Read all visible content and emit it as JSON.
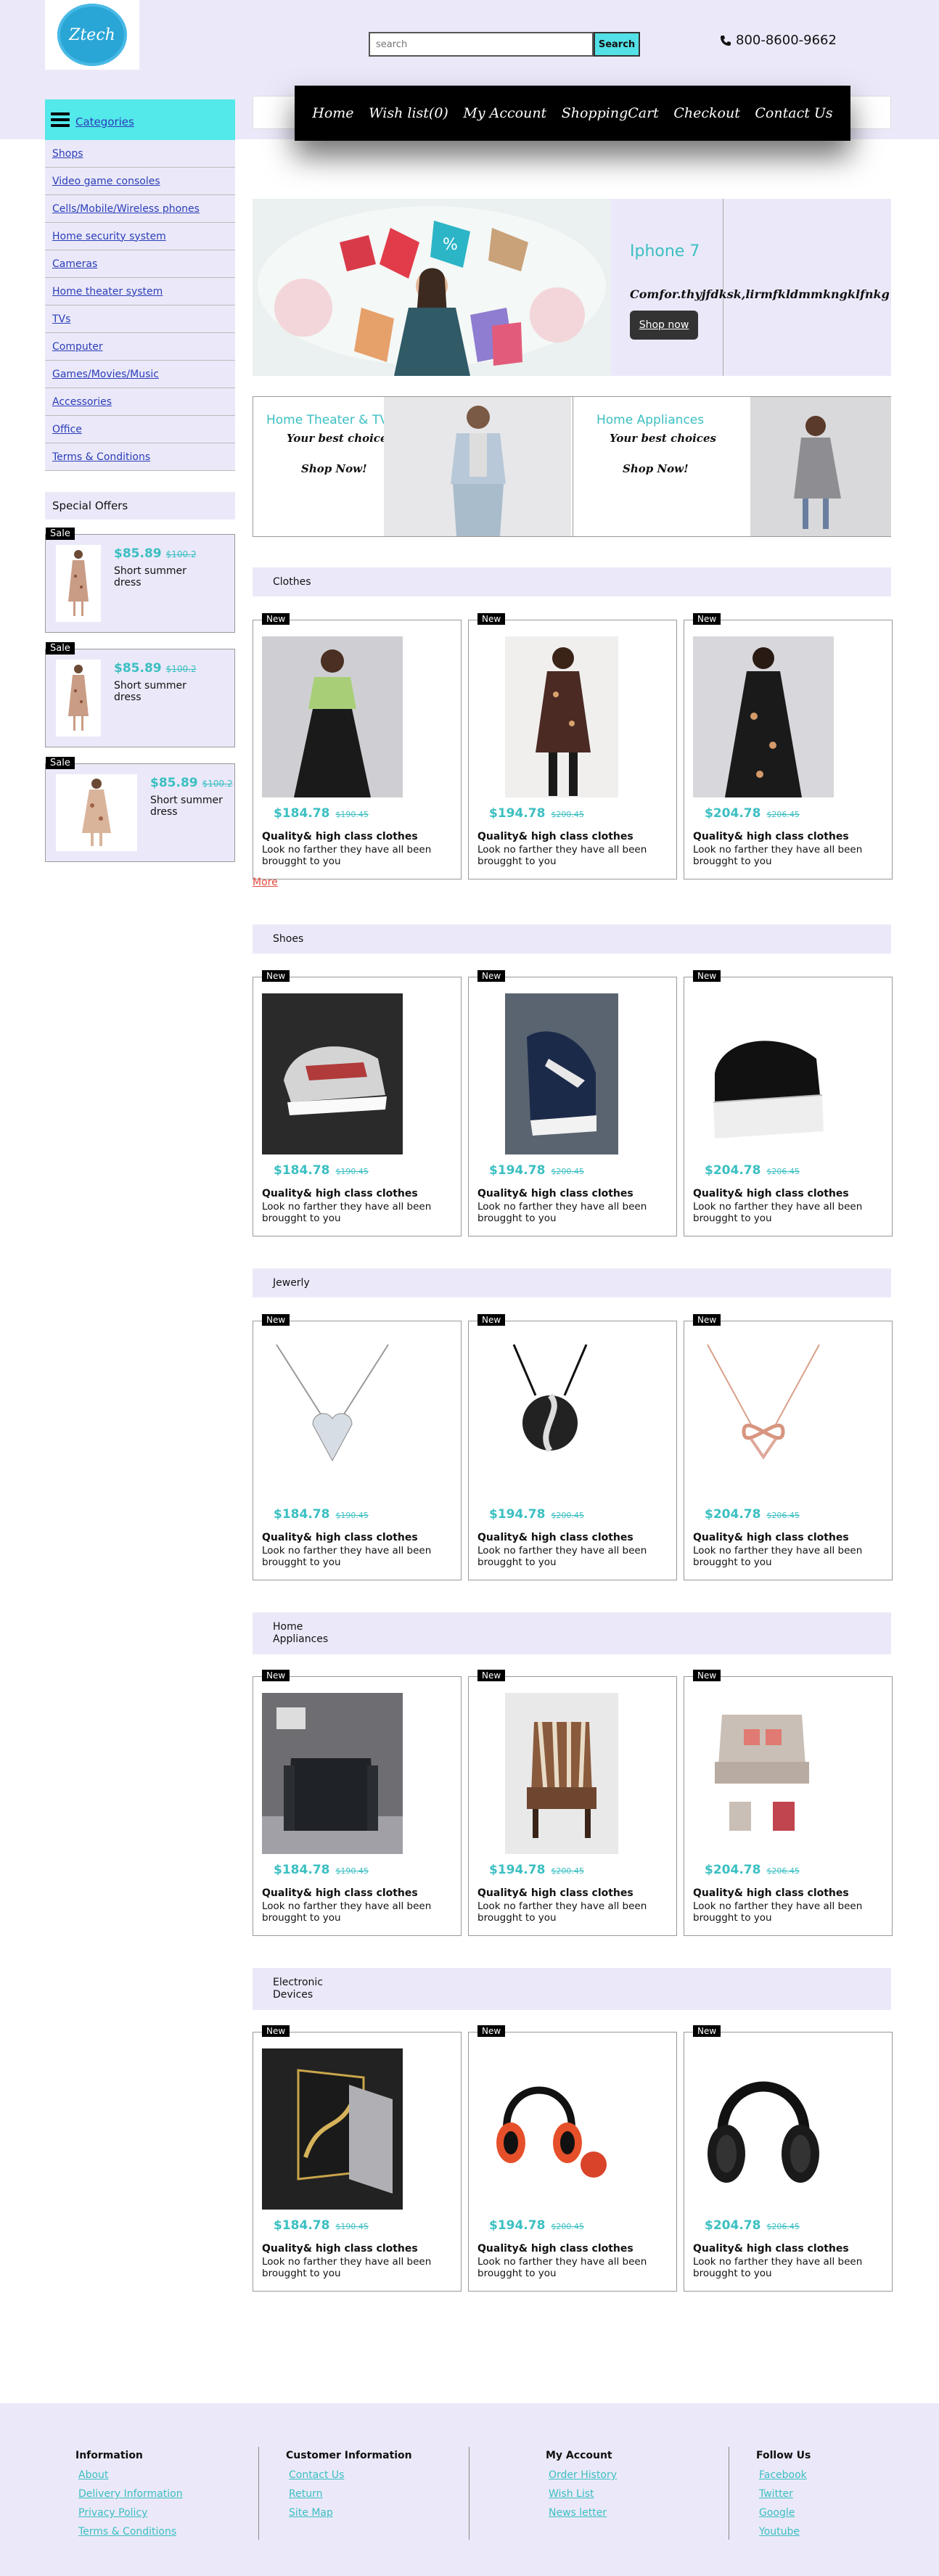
{
  "header": {
    "logo_text": "Ztech",
    "search_placeholder": "search",
    "search_button": "Search",
    "phone": "800-8600-9662"
  },
  "nav": [
    "Home",
    "Wish list(0)",
    "My Account",
    "ShoppingCart",
    "Checkout",
    "Contact Us"
  ],
  "sidebar": {
    "categories_title": "Categories",
    "items": [
      "Shops",
      "Video game consoles",
      "Cells/Mobile/Wireless phones",
      "Home security system",
      "Cameras",
      "Home theater system",
      "TVs",
      "Computer",
      "Games/Movies/Music",
      "Accessories",
      "Office",
      "Terms & Conditions"
    ],
    "special_title": "Special Offers",
    "offers": [
      {
        "badge": "Sale",
        "price": "$85.89",
        "old_price": "$100.2",
        "name": "Short summer dress"
      },
      {
        "badge": "Sale",
        "price": "$85.89",
        "old_price": "$100.2",
        "name": "Short summer dress"
      },
      {
        "badge": "Sale",
        "price": "$85.89",
        "old_price": "$100.2",
        "name": "Short summer dress"
      }
    ]
  },
  "banner": {
    "title": "Iphone 7",
    "subtitle": "Comfor.thyjfdksk,lirmfkldmmkngklfnkg",
    "button": "Shop now"
  },
  "promos": [
    {
      "title": "Home Theater & TV",
      "sub": "Your best choices",
      "shop": "Shop Now!"
    },
    {
      "title": "Home Appliances",
      "sub": "Your best choices",
      "shop": "Shop Now!"
    }
  ],
  "product_template": {
    "badge": "New",
    "title": "Quality& high class clothes",
    "desc": "Look no farther they have all been brougght to you",
    "prices": [
      {
        "price": "$184.78",
        "old": "$190.45"
      },
      {
        "price": "$194.78",
        "old": "$200.45"
      },
      {
        "price": "$204.78",
        "old": "$206.45"
      }
    ]
  },
  "sections": [
    "Clothes",
    "Shoes",
    "Jewerly",
    "Home Appliances",
    "Electronic Devices"
  ],
  "more_link": "More",
  "footer": {
    "columns": [
      {
        "title": "Information",
        "links": [
          "About",
          "Delivery Information",
          "Privacy Policy",
          "Terms & Conditions"
        ]
      },
      {
        "title": "Customer Information",
        "links": [
          "Contact Us",
          "Return",
          "Site Map"
        ]
      },
      {
        "title": "My Account",
        "links": [
          "Order History",
          "Wish List",
          "News letter"
        ]
      },
      {
        "title": "Follow Us",
        "links": [
          "Facebook",
          "Twitter",
          "Google",
          "Youtube"
        ]
      }
    ]
  },
  "colors": {
    "accent": "#3bbfc2",
    "cyan": "#53e8ea",
    "panel": "#ebe9f9",
    "link": "#2a3db8",
    "more": "#e24a3b"
  }
}
